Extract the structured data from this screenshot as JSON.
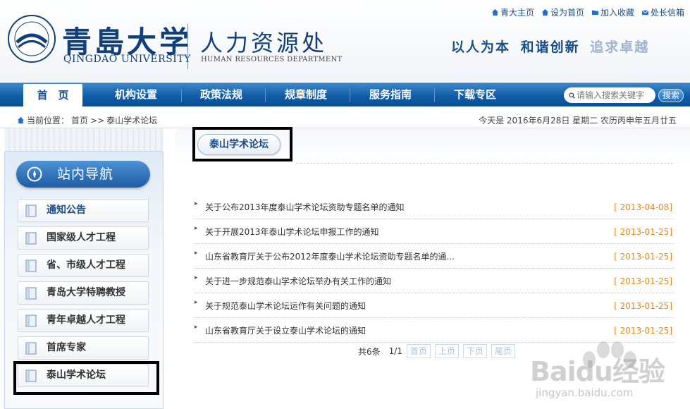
{
  "header": {
    "toplinks": [
      {
        "label": "青大主页",
        "icon": "home-icon"
      },
      {
        "label": "设为首页",
        "icon": "home-icon"
      },
      {
        "label": "加入收藏",
        "icon": "folder-icon"
      },
      {
        "label": "处长信箱",
        "icon": "mail-icon"
      }
    ],
    "logo_cn": "青島大学",
    "logo_en": "QINGDAO UNIVERSITY",
    "dept_cn": "人力资源处",
    "dept_en": "HUMAN RESOURCES DEPARTMENT",
    "slogan_a": "以人为本",
    "slogan_b": "和谐创新",
    "slogan_c": "追求卓越"
  },
  "nav": {
    "items": [
      "首　页",
      "机构设置",
      "政策法规",
      "规章制度",
      "服务指南",
      "下载专区"
    ],
    "search_placeholder": "请输入搜索关键字",
    "search_button": "搜索"
  },
  "crumb": {
    "prefix": "当前位置：",
    "home": "首页",
    "sep": ">>",
    "current": "泰山学术论坛",
    "date": "今天是 2016年6月28日 星期二  农历丙申年五月廿五"
  },
  "sidebar": {
    "title": "站内导航",
    "items": [
      "通知公告",
      "国家级人才工程",
      "省、市级人才工程",
      "青岛大学特聘教授",
      "青年卓越人才工程",
      "首席专家",
      "泰山学术论坛"
    ]
  },
  "main": {
    "section_title": "泰山学术论坛",
    "news": [
      {
        "title": "关于公布2013年度泰山学术论坛资助专题名单的通知",
        "date": "[ 2013-04-08]"
      },
      {
        "title": "关于开展2013年泰山学术论坛申报工作的通知",
        "date": "[ 2013-01-25]"
      },
      {
        "title": "山东省教育厅关于公布2012年度泰山学术论坛资助专题名单的通...",
        "date": "[ 2013-01-25]"
      },
      {
        "title": "关于进一步规范泰山学术论坛举办有关工作的通知",
        "date": "[ 2013-01-25]"
      },
      {
        "title": "关于规范泰山学术论坛运作有关问题的通知",
        "date": "[ 2013-01-25]"
      },
      {
        "title": "山东省教育厅关于设立泰山学术论坛的通知",
        "date": "[ 2013-01-25]"
      }
    ],
    "pager": {
      "total": "共6条",
      "page": "1/1",
      "first": "首页",
      "prev": "上页",
      "next": "下页",
      "last": "尾页"
    }
  },
  "watermark": {
    "text": "Baidu经验",
    "url": "jingyan.baidu.com"
  }
}
